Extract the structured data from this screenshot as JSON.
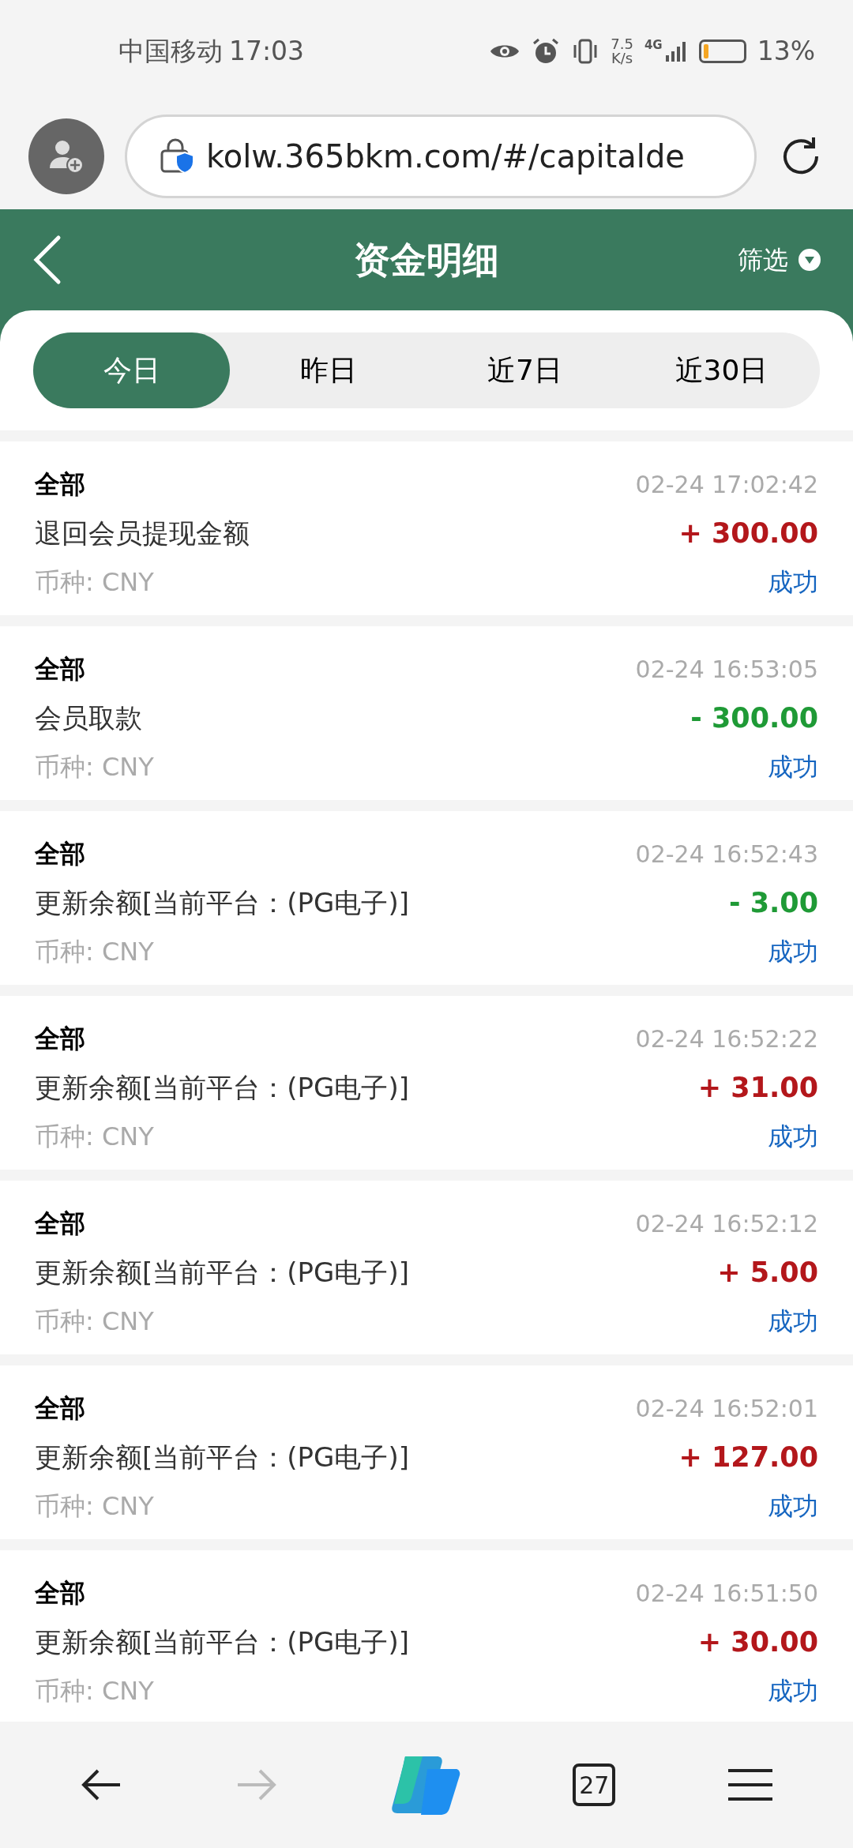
{
  "status_bar": {
    "carrier": "中国移动",
    "time": "17:03",
    "net_speed_value": "7.5",
    "net_speed_unit": "K/s",
    "network": "4G",
    "battery": "13%"
  },
  "browser": {
    "url": "kolw.365bkm.com/#/capitalde",
    "tab_count": "27"
  },
  "header": {
    "title": "资金明细",
    "filter": "筛选"
  },
  "tabs": [
    {
      "label": "今日",
      "selected": true
    },
    {
      "label": "昨日",
      "selected": false
    },
    {
      "label": "近7日",
      "selected": false
    },
    {
      "label": "近30日",
      "selected": false
    }
  ],
  "records": [
    {
      "category": "全部",
      "time": "02-24 17:02:42",
      "description": "退回会员提现金额",
      "amount": "+ 300.00",
      "kind": "credit",
      "currency": "币种: CNY",
      "status": "成功"
    },
    {
      "category": "全部",
      "time": "02-24 16:53:05",
      "description": "会员取款",
      "amount": "- 300.00",
      "kind": "debit",
      "currency": "币种: CNY",
      "status": "成功"
    },
    {
      "category": "全部",
      "time": "02-24 16:52:43",
      "description": "更新余额[当前平台：(PG电子)]",
      "amount": "- 3.00",
      "kind": "debit",
      "currency": "币种: CNY",
      "status": "成功"
    },
    {
      "category": "全部",
      "time": "02-24 16:52:22",
      "description": "更新余额[当前平台：(PG电子)]",
      "amount": "+ 31.00",
      "kind": "credit",
      "currency": "币种: CNY",
      "status": "成功"
    },
    {
      "category": "全部",
      "time": "02-24 16:52:12",
      "description": "更新余额[当前平台：(PG电子)]",
      "amount": "+ 5.00",
      "kind": "credit",
      "currency": "币种: CNY",
      "status": "成功"
    },
    {
      "category": "全部",
      "time": "02-24 16:52:01",
      "description": "更新余额[当前平台：(PG电子)]",
      "amount": "+ 127.00",
      "kind": "credit",
      "currency": "币种: CNY",
      "status": "成功"
    },
    {
      "category": "全部",
      "time": "02-24 16:51:50",
      "description": "更新余额[当前平台：(PG电子)]",
      "amount": "+ 30.00",
      "kind": "credit",
      "currency": "币种: CNY",
      "status": "成功"
    }
  ]
}
